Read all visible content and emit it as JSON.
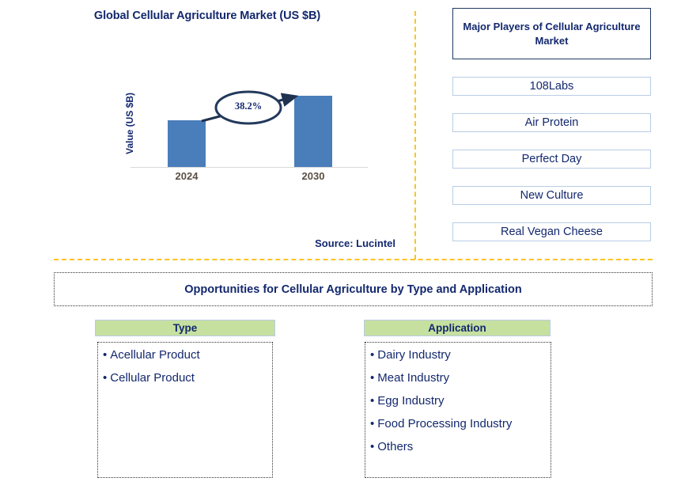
{
  "chart_data": {
    "type": "bar",
    "title": "Global Cellular Agriculture Market (US $B)",
    "xlabel": "",
    "ylabel": "Value (US $B)",
    "categories": [
      "2024",
      "2030"
    ],
    "values": [
      59,
      90
    ],
    "grid": false,
    "legend": "none",
    "annotation": "38.2%",
    "annotation_kind": "CAGR growth arrow from 2024 to 2030",
    "bar_color": "#4a7ebb",
    "axis_label_color": "#5a4f44",
    "title_color": "#13286e"
  },
  "chart_panel": {
    "title": "Global Cellular Agriculture Market (US $B)",
    "y_axis_label": "Value (US $B)",
    "x_ticks": [
      "2024",
      "2030"
    ],
    "cagr_label": "38.2%",
    "source": "Source: Lucintel"
  },
  "players_panel": {
    "title": "Major Players of Cellular Agriculture Market",
    "items": [
      "108Labs",
      "Air Protein",
      "Perfect Day",
      "New Culture",
      "Real Vegan Cheese"
    ]
  },
  "opportunities": {
    "banner": "Opportunities for Cellular Agriculture by Type and Application",
    "columns": [
      {
        "header": "Type",
        "items": [
          "Acellular Product",
          "Cellular Product"
        ]
      },
      {
        "header": "Application",
        "items": [
          "Dairy Industry",
          "Meat Industry",
          "Egg Industry",
          "Food Processing Industry",
          "Others"
        ]
      }
    ],
    "bullet": "•"
  },
  "colors": {
    "accent_navy": "#13286e",
    "bar_blue": "#4a7ebb",
    "divider_orange": "#ffc222",
    "header_green": "#c6e0a0",
    "box_border_blue": "#b8cce4"
  }
}
